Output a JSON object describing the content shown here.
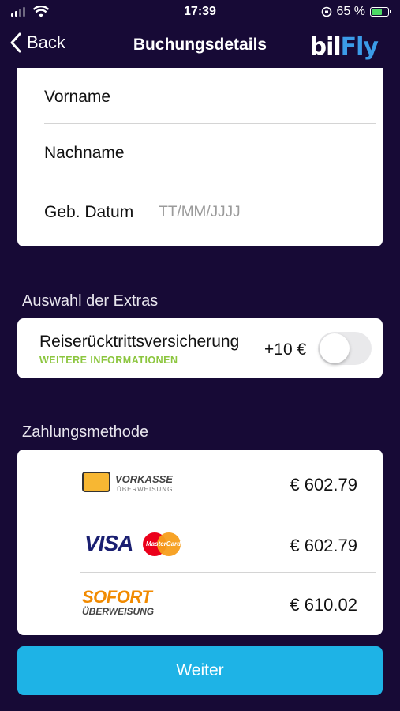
{
  "status_bar": {
    "time": "17:39",
    "battery_percent": "65 %",
    "battery_level": 0.65,
    "icons": [
      "signal-icon",
      "wifi-icon",
      "orientation-lock-icon",
      "battery-charging-icon"
    ]
  },
  "nav": {
    "back_label": "Back",
    "title": "Buchungsdetails",
    "brand_part1": "bil",
    "brand_part2": "Fly",
    "brand_color": "#3b9be8"
  },
  "form": {
    "first_name_label": "Vorname",
    "last_name_label": "Nachname",
    "birthdate_label": "Geb. Datum",
    "birthdate_placeholder": "TT/MM/JJJJ"
  },
  "extras": {
    "section_label": "Auswahl der Extras",
    "insurance_title": "Reiserücktrittsversicherung",
    "more_info_link": "WEITERE INFORMATIONEN",
    "price": "+10 €",
    "toggle_on": false
  },
  "payment": {
    "section_label": "Zahlungsmethode",
    "methods": [
      {
        "logo_text": "VORKASSE",
        "logo_sub": "ÜBERWEISUNG",
        "price": "€ 602.79"
      },
      {
        "logo_text": "VISA",
        "logo_sub": "MasterCard",
        "price": "€ 602.79"
      },
      {
        "logo_text": "SOFORT",
        "logo_sub": "ÜBERWEISUNG",
        "price": "€ 610.02"
      }
    ]
  },
  "continue_button": "Weiter",
  "colors": {
    "background": "#170a36",
    "accent_button": "#1eb3e6",
    "link_green": "#8cc63f"
  }
}
